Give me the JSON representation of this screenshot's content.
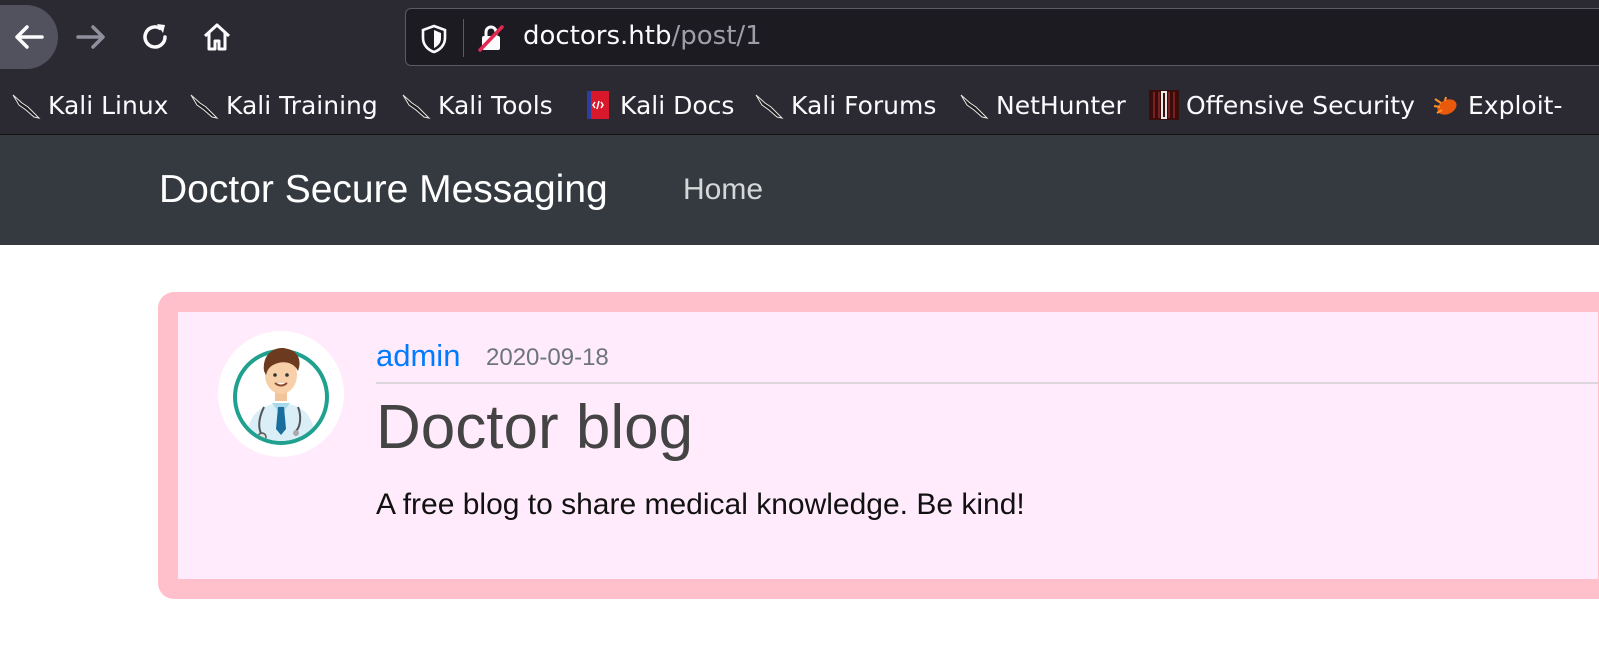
{
  "browser": {
    "url_host": "doctors.htb",
    "url_path": "/post/1",
    "bookmarks": [
      {
        "label": "Kali Linux",
        "icon": "kali-dragon-icon"
      },
      {
        "label": "Kali Training",
        "icon": "kali-dragon-icon"
      },
      {
        "label": "Kali Tools",
        "icon": "kali-dragon-icon"
      },
      {
        "label": "Kali Docs",
        "icon": "kali-docs-icon"
      },
      {
        "label": "Kali Forums",
        "icon": "kali-dragon-icon"
      },
      {
        "label": "NetHunter",
        "icon": "kali-dragon-icon"
      },
      {
        "label": "Offensive Security",
        "icon": "offsec-icon"
      },
      {
        "label": "Exploit-",
        "icon": "exploit-db-icon"
      }
    ]
  },
  "site": {
    "brand": "Doctor Secure Messaging",
    "nav_home": "Home"
  },
  "post": {
    "author": "admin",
    "date": "2020-09-18",
    "title": "Doctor blog",
    "content": "A free blog to share medical knowledge. Be kind!"
  },
  "colors": {
    "navbar": "#343a40",
    "card_border": "#ffc0cb",
    "card_bg": "#ffebfc",
    "link": "#007bff"
  }
}
